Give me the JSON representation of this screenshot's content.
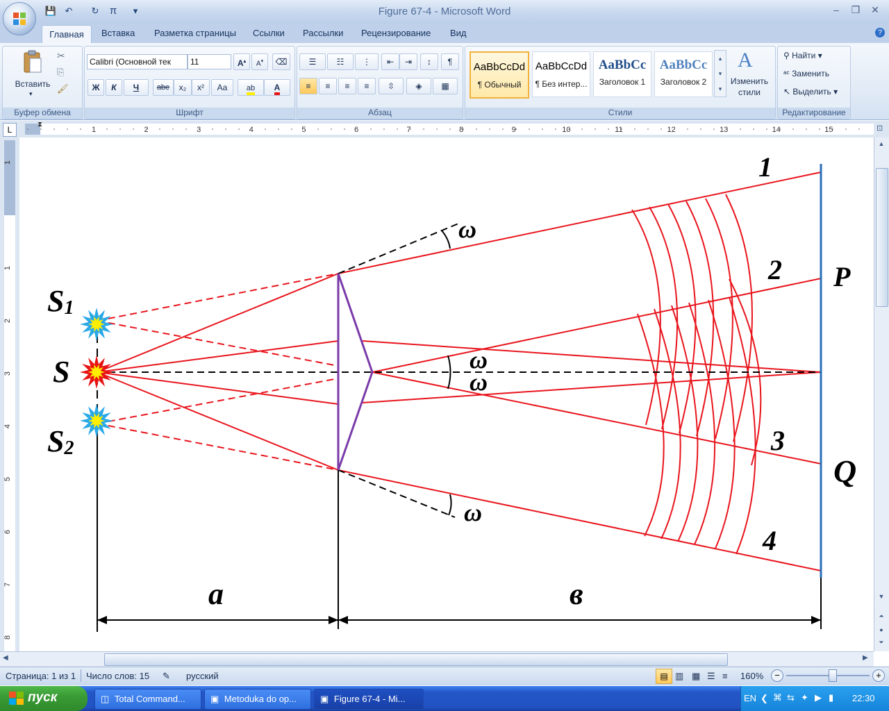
{
  "window": {
    "title": "Figure 67-4 - Microsoft Word"
  },
  "quick_access": [
    "save-icon",
    "undo-icon",
    "redo-icon",
    "pi-icon",
    "customize-icon"
  ],
  "tabs": [
    {
      "label": "Главная",
      "active": true
    },
    {
      "label": "Вставка"
    },
    {
      "label": "Разметка страницы"
    },
    {
      "label": "Ссылки"
    },
    {
      "label": "Рассылки"
    },
    {
      "label": "Рецензирование"
    },
    {
      "label": "Вид"
    }
  ],
  "ribbon": {
    "clipboard": {
      "label": "Буфер обмена",
      "paste_label": "Вставить"
    },
    "font": {
      "label": "Шрифт",
      "font_name": "Calibri (Основной тек",
      "font_size": "11",
      "bold": "Ж",
      "italic": "К",
      "underline": "Ч",
      "strike": "abe",
      "sub": "x₂",
      "sup": "x²",
      "case": "Aa"
    },
    "paragraph": {
      "label": "Абзац"
    },
    "styles": {
      "label": "Стили",
      "items": [
        {
          "sample": "AaBbCcDd",
          "name": "¶ Обычный"
        },
        {
          "sample": "AaBbCcDd",
          "name": "¶ Без интер..."
        },
        {
          "sample": "AaBbCc",
          "name": "Заголовок 1"
        },
        {
          "sample": "AaBbCc",
          "name": "Заголовок 2"
        }
      ],
      "change_label_1": "Изменить",
      "change_label_2": "стили"
    },
    "editing": {
      "label": "Редактирование",
      "find": "Найти",
      "replace": "Заменить",
      "select": "Выделить"
    }
  },
  "ruler": {
    "h_numbers": [
      "1",
      "2",
      "3",
      "4",
      "5",
      "6",
      "7",
      "8",
      "9",
      "10",
      "11",
      "12",
      "13",
      "14",
      "15"
    ],
    "v_numbers": [
      "1",
      "1",
      "2",
      "3",
      "4",
      "5",
      "6",
      "7",
      "8"
    ]
  },
  "figure": {
    "labels": {
      "s1": "S",
      "s1_sub": "1",
      "s": "S",
      "s2": "S",
      "s2_sub": "2",
      "omega": "ω",
      "ray1": "1",
      "ray2": "2",
      "ray3": "3",
      "ray4": "4",
      "p": "P",
      "q": "Q",
      "a": "a",
      "b": "в"
    },
    "colors": {
      "ray": "#e8141c",
      "prism": "#7a3aa8",
      "screen": "#2a6fb8",
      "dashed": "#000000",
      "star_blue": "#2aa9e8",
      "star_red": "#e81414",
      "star_yellow": "#ffee00"
    }
  },
  "status": {
    "page": "Страница: 1 из 1",
    "words": "Число слов: 15",
    "language": "русский",
    "zoom": "160%"
  },
  "taskbar": {
    "start": "пуск",
    "tasks": [
      {
        "label": "Total Command..."
      },
      {
        "label": "Metoduka do op..."
      },
      {
        "label": "Figure 67-4 - Mi..."
      }
    ],
    "lang": "EN",
    "time": "22:30"
  }
}
